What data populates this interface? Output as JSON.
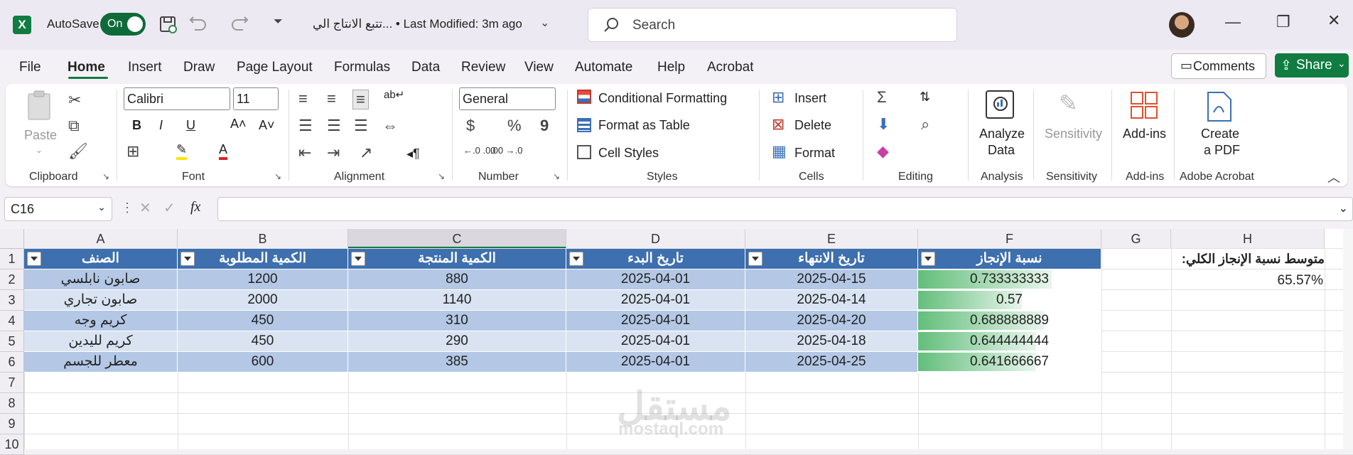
{
  "titlebar": {
    "logo": "X",
    "autosave_label": "AutoSave",
    "toggle_label": "On",
    "doc_title": "تتبع الانتاج الي... • Last Modified: 3m ago",
    "search_placeholder": "Search",
    "icons": [
      "excel-icon",
      "save-icon",
      "undo-icon",
      "redo-icon",
      "customize-icon",
      "search-icon",
      "minimize-icon",
      "restore-icon",
      "close-icon"
    ]
  },
  "menu": {
    "items": [
      "File",
      "Home",
      "Insert",
      "Draw",
      "Page Layout",
      "Formulas",
      "Data",
      "Review",
      "View",
      "Automate",
      "Help",
      "Acrobat"
    ],
    "active": "Home",
    "comments": "Comments",
    "share": "Share"
  },
  "ribbon": {
    "clipboard": {
      "paste": "Paste",
      "label": "Clipboard"
    },
    "font": {
      "name": "Calibri",
      "size": "11",
      "label": "Font"
    },
    "alignment": {
      "label": "Alignment"
    },
    "number": {
      "format": "General",
      "label": "Number",
      "currency": "$",
      "percent": "%",
      "comma": "9",
      "inc_decimal": "←.0 .00",
      "dec_decimal": ".00 →.0"
    },
    "styles": {
      "cond": "Conditional Formatting",
      "table": "Format as Table",
      "cell": "Cell Styles",
      "label": "Styles"
    },
    "cells": {
      "insert": "Insert",
      "delete": "Delete",
      "format": "Format",
      "label": "Cells"
    },
    "editing": {
      "label": "Editing"
    },
    "analysis": {
      "btn1": "Analyze",
      "btn2": "Data",
      "label": "Analysis"
    },
    "sensitivity": {
      "btn": "Sensitivity",
      "label": "Sensitivity"
    },
    "addins": {
      "btn": "Add-ins",
      "label": "Add-ins"
    },
    "acrobat": {
      "btn1": "Create",
      "btn2": "a PDF",
      "label": "Adobe Acrobat"
    }
  },
  "formula_bar": {
    "name_box": "C16",
    "fx": "fx",
    "content": ""
  },
  "sheet": {
    "columns": [
      "A",
      "B",
      "C",
      "D",
      "E",
      "F",
      "G",
      "H"
    ],
    "row_numbers": [
      "1",
      "2",
      "3",
      "4",
      "5",
      "6",
      "7",
      "8",
      "9",
      "10"
    ],
    "headers": [
      "الصنف",
      "الكمية المطلوبة",
      "الكمية المنتجة",
      "تاريخ البدء",
      "تاريخ الانتهاء",
      "نسبة الإنجاز"
    ],
    "rows": [
      [
        "صابون نابلسي",
        "1200",
        "880",
        "2025-04-01",
        "2025-04-15",
        "0.733333333"
      ],
      [
        "صابون تجاري",
        "2000",
        "1140",
        "2025-04-01",
        "2025-04-14",
        "0.57"
      ],
      [
        "كريم وجه",
        "450",
        "310",
        "2025-04-01",
        "2025-04-20",
        "0.688888889"
      ],
      [
        "كريم لليدين",
        "450",
        "290",
        "2025-04-01",
        "2025-04-18",
        "0.644444444"
      ],
      [
        "معطر للجسم",
        "600",
        "385",
        "2025-04-01",
        "2025-04-25",
        "0.641666667"
      ]
    ],
    "progress": [
      0.733333333,
      0.57,
      0.688888889,
      0.644444444,
      0.641666667
    ],
    "summary_label": "متوسط نسبة الإنجاز الكلي:",
    "summary_value": "65.57%",
    "colors": {
      "header": "#3e6fae",
      "band1": "#b4c8e6",
      "band2": "#d9e3f2",
      "databar": "#63be7b"
    }
  },
  "watermark": {
    "arabic": "مستقل",
    "latin": "mostaql.com"
  }
}
